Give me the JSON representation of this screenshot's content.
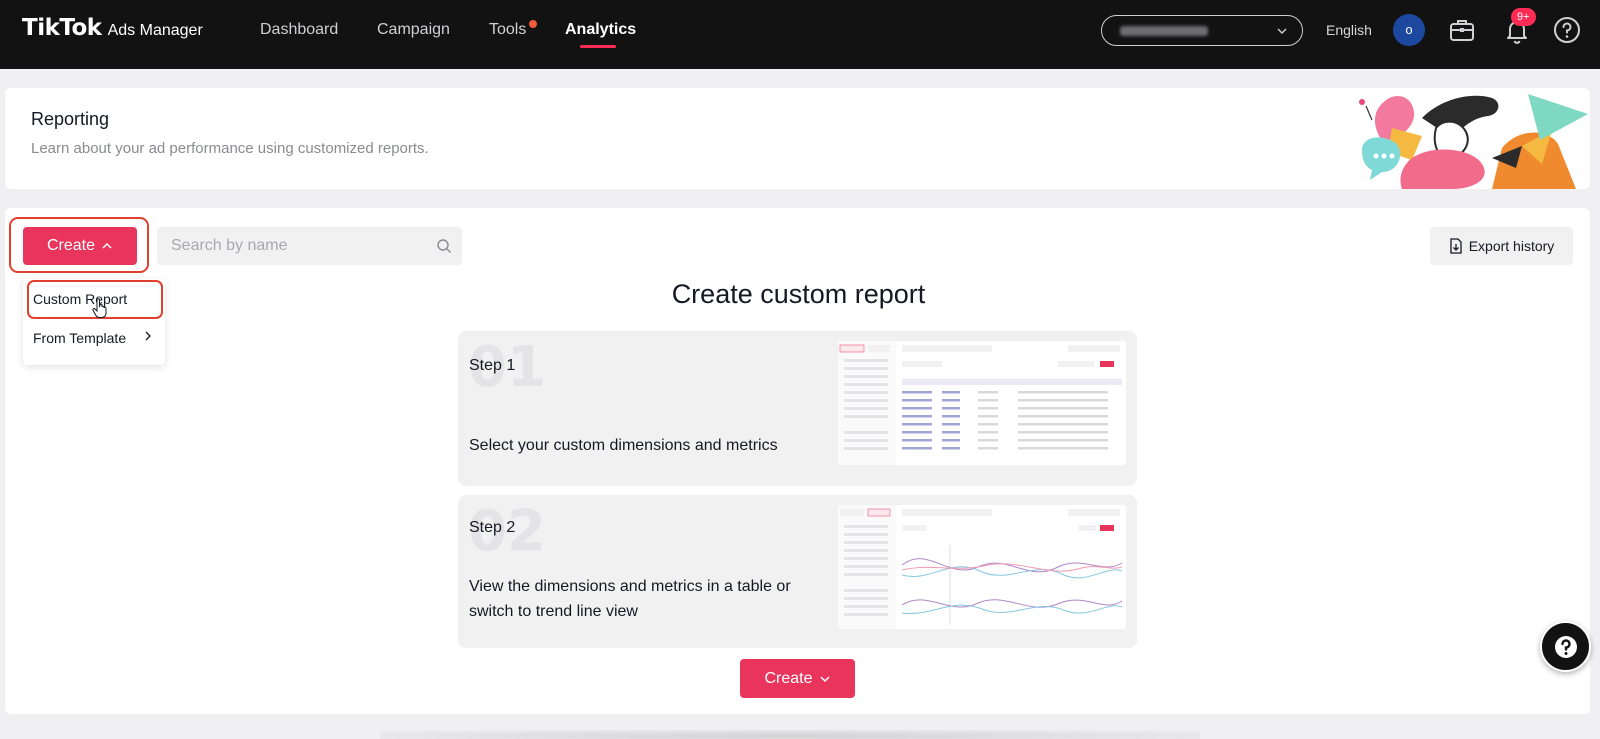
{
  "topbar": {
    "brand": "TikTok",
    "product": "Ads Manager",
    "nav": [
      "Dashboard",
      "Campaign",
      "Tools",
      "Analytics"
    ],
    "active_nav": "Analytics",
    "language": "English",
    "avatar_initial": "o",
    "notification_badge": "9+",
    "icons": [
      "chevron-down-icon",
      "briefcase-icon",
      "bell-icon",
      "help-circle-icon"
    ]
  },
  "header": {
    "title": "Reporting",
    "subtitle": "Learn about your ad performance using customized reports."
  },
  "toolbar": {
    "create_label": "Create",
    "search_placeholder": "Search by name",
    "export_label": "Export history"
  },
  "dropdown": {
    "items": [
      "Custom Report",
      "From Template"
    ]
  },
  "main": {
    "title": "Create custom report",
    "steps": [
      {
        "number": "01",
        "label": "Step 1",
        "description": "Select your custom dimensions and metrics"
      },
      {
        "number": "02",
        "label": "Step 2",
        "description": "View the dimensions and metrics in a table or switch to trend line view"
      }
    ],
    "create_label": "Create"
  },
  "colors": {
    "accent": "#e9345b",
    "topbar_bg": "#121212",
    "highlight_outline": "#e0402d"
  }
}
